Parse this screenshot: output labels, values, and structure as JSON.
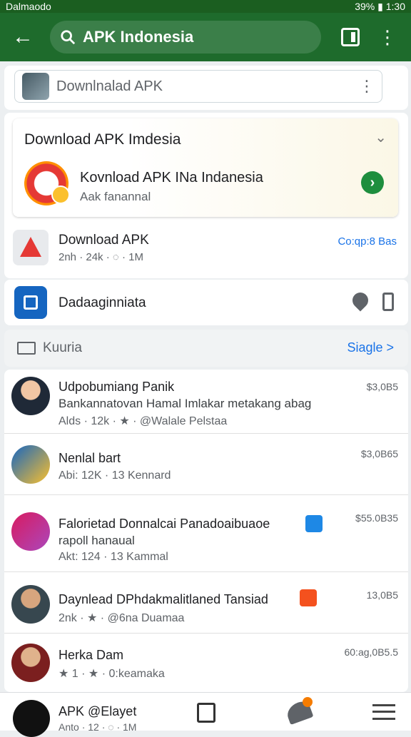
{
  "status": {
    "left": "Dalmaodo",
    "right": "39% ▮ 1:30"
  },
  "appbar": {
    "search_query": "APK Indonesia"
  },
  "suggest": {
    "label": "Downlnalad APK"
  },
  "featured": {
    "header": "Download APK Imdesia",
    "title": "Kovnload APK INa Indanesia",
    "subtitle": "Aak fanannal"
  },
  "app_row": {
    "title": "Download APK",
    "meta": "2nh · 24k · ◌ · 1M",
    "right": "Co:qp:8 Bas"
  },
  "d_row": {
    "label": "Dadaaginniata"
  },
  "category": {
    "label": "Kuuria",
    "action": "Siagle >"
  },
  "items": [
    {
      "title": "Udpobumiang Panik",
      "desc": "Bankannatovan Hamal Imlakar metakang abag",
      "meta": "Alds · 12k · ★ · @Walale Pelstaa",
      "price": "$3,0B5"
    },
    {
      "title": "Nenlal bart",
      "desc": "",
      "meta": "Abi: 12K · 13 Kennard",
      "price": "$3,0B65"
    },
    {
      "title": "Falorietad Donnalcai Panadoaibuaoe",
      "desc": "rapoll hanaual",
      "meta": "Akt: 124 · 13 Kammal",
      "price": "$55.0B35"
    },
    {
      "title": "Daynlead DPhdakmalitlaned Tansiad",
      "desc": "",
      "meta": "2nk · ★ · @6na Duamaa",
      "price": "13,0B5"
    },
    {
      "title": "Herka Dam",
      "desc": "",
      "meta": "★ 1 · ★ · 0:keamaka",
      "price": "60:ag,0B5.5"
    }
  ],
  "bottom": {
    "title": "APK @Elayet",
    "meta": "Anto · 12 · ◌ · 1M"
  }
}
